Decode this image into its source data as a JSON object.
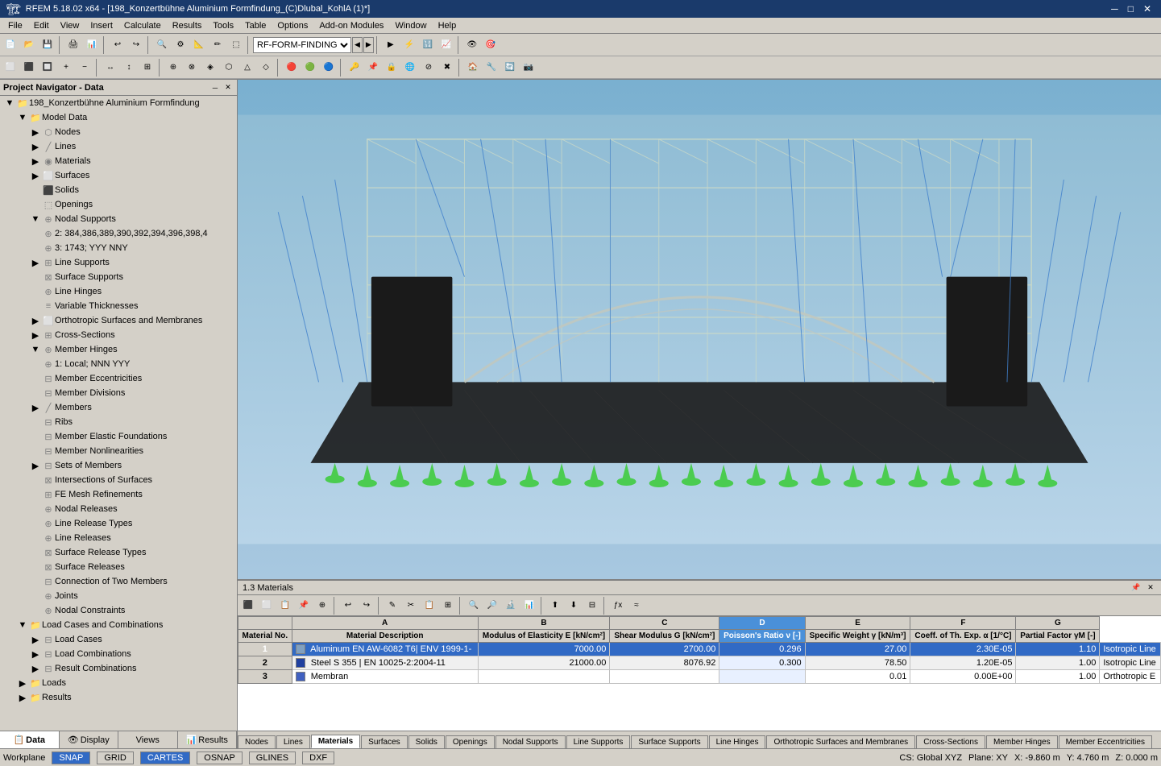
{
  "titleBar": {
    "text": "RFEM 5.18.02 x64 - [198_Konzertbühne Aluminium Formfindung_(C)Dlubal_KohlA (1)*]",
    "minimize": "─",
    "maximize": "□",
    "close": "✕",
    "innerClose": "✕",
    "innerMax": "□",
    "innerMin": "─"
  },
  "menuBar": {
    "items": [
      "File",
      "Edit",
      "View",
      "Insert",
      "Calculate",
      "Results",
      "Tools",
      "Table",
      "Options",
      "Add-on Modules",
      "Window",
      "Help"
    ]
  },
  "sidebar": {
    "title": "Project Navigator - Data",
    "rootNode": "198_Konzertbühne Aluminium Formfindung",
    "modelData": "Model Data",
    "nodes": "Nodes",
    "lines": "Lines",
    "materials": "Materials",
    "surfaces": "Surfaces",
    "solids": "Solids",
    "openings": "Openings",
    "nodalSupports": "Nodal Supports",
    "nodalSupport1": "2: 384,386,389,390,392,394,396,398,4",
    "nodalSupport2": "3: 1743; YYY NNY",
    "lineSupports": "Line Supports",
    "surfaceSupports": "Surface Supports",
    "lineHinges": "Line Hinges",
    "variableThicknesses": "Variable Thicknesses",
    "orthotropicSurfaces": "Orthotropic Surfaces and Membranes",
    "crossSections": "Cross-Sections",
    "memberHinges": "Member Hinges",
    "memberHinge1": "1: Local; NNN YYY",
    "memberEccentricities": "Member Eccentricities",
    "memberDivisions": "Member Divisions",
    "members": "Members",
    "ribs": "Ribs",
    "memberElasticFoundations": "Member Elastic Foundations",
    "memberNonlinearities": "Member Nonlinearities",
    "setsOfMembers": "Sets of Members",
    "intersectionsOfSurfaces": "Intersections of Surfaces",
    "feMeshRefinements": "FE Mesh Refinements",
    "nodalReleases": "Nodal Releases",
    "lineReleaseTypes": "Line Release Types",
    "lineReleases": "Line Releases",
    "surfaceReleaseTypes": "Surface Release Types",
    "surfaceReleases": "Surface Releases",
    "connectionOfTwoMembers": "Connection of Two Members",
    "joints": "Joints",
    "nodalConstraints": "Nodal Constraints",
    "loadCasesAndCombinations": "Load Cases and Combinations",
    "loadCases": "Load Cases",
    "loadCombinations": "Load Combinations",
    "resultCombinations": "Result Combinations",
    "loads": "Loads",
    "results": "Results"
  },
  "navTabs": [
    "Data",
    "Display",
    "Views",
    "Results"
  ],
  "viewport": {
    "moduleLabel": "RF-FORM-FINDING"
  },
  "bottomPanel": {
    "title": "1.3 Materials"
  },
  "table": {
    "columns": {
      "rowNum": "",
      "A": "A",
      "B": "B",
      "C": "C",
      "D": "D",
      "E": "E",
      "F": "F",
      "G": "G"
    },
    "subHeaders": {
      "rowNum": "Material No.",
      "A": "Material Description",
      "B": "Modulus of Elasticity E [kN/cm²]",
      "C": "Shear Modulus G [kN/cm²]",
      "D": "Poisson's Ratio ν [-]",
      "E": "Specific Weight γ [kN/m³]",
      "F": "Coeff. of Th. Exp. α [1/°C]",
      "G": "Partial Factor γM [-]"
    },
    "rows": [
      {
        "num": "1",
        "A": "Aluminum EN AW-6082 T6| ENV 1999-1-",
        "B": "7000.00",
        "C": "2700.00",
        "D": "0.296",
        "E": "27.00",
        "F": "2.30E-05",
        "G": "1.10",
        "extra": "Isotropic Line",
        "selected": true
      },
      {
        "num": "2",
        "A": "Steel S 355 | EN 10025-2:2004-11",
        "B": "21000.00",
        "C": "8076.92",
        "D": "0.300",
        "E": "78.50",
        "F": "1.20E-05",
        "G": "1.00",
        "extra": "Isotropic Line",
        "selected": false
      },
      {
        "num": "3",
        "A": "Membran",
        "B": "",
        "C": "",
        "D": "",
        "E": "0.01",
        "F": "0.00E+00",
        "G": "1.00",
        "extra": "Orthotropic E",
        "selected": false
      }
    ]
  },
  "bottomTabs": [
    "Nodes",
    "Lines",
    "Materials",
    "Surfaces",
    "Solids",
    "Openings",
    "Nodal Supports",
    "Line Supports",
    "Surface Supports",
    "Line Hinges",
    "Orthotropic Surfaces and Membranes",
    "Cross-Sections",
    "Member Hinges",
    "Member Eccentricities"
  ],
  "activeBottomTab": "Materials",
  "statusBar": {
    "workplane": "Workplane",
    "snap": "SNAP",
    "grid": "GRID",
    "cartes": "CARTES",
    "osnap": "OSNAP",
    "glines": "GLINES",
    "dxf": "DXF",
    "cs": "CS: Global XYZ",
    "plane": "Plane: XY",
    "x": "X: -9.860 m",
    "y": "Y: 4.760 m",
    "z": "Z: 0.000 m"
  }
}
